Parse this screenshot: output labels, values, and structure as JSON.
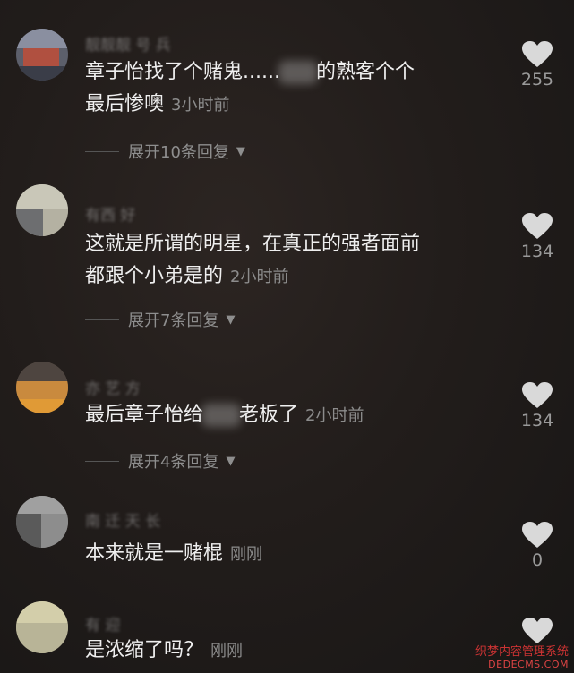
{
  "comments": [
    {
      "username": "靓靓靓 号 兵",
      "text_before": "章子怡找了个赌鬼......",
      "text_after": "的熟客个个",
      "text_line2": "最后惨噢",
      "time": "3小时前",
      "expand_label": "展开10条回复",
      "likes": "255"
    },
    {
      "username": "有西 好",
      "text_line1": "这就是所谓的明星，在真正的强者面前",
      "text_line2": "都跟个小弟是的",
      "time": "2小时前",
      "expand_label": "展开7条回复",
      "likes": "134"
    },
    {
      "username": "亦 艺 方",
      "text_before": "最后章子怡给",
      "text_after": "老板了",
      "time": "2小时前",
      "expand_label": "展开4条回复",
      "likes": "134"
    },
    {
      "username": "南 迁 天 长",
      "text": "本来就是一赌棍",
      "time": "刚刚",
      "likes": "0"
    },
    {
      "username": "有 迎",
      "text": "是浓缩了吗？",
      "time": "刚刚",
      "likes": ""
    }
  ],
  "icons": {
    "like": "heart-icon",
    "expand": "caret-down-icon"
  },
  "colors": {
    "background": "#1e1a18",
    "text": "#efefef",
    "muted": "#8c8c8c",
    "heart": "#d9d9d9"
  },
  "watermark": {
    "line1": "织梦内容管理系统",
    "line2": "DEDECMS.COM"
  }
}
